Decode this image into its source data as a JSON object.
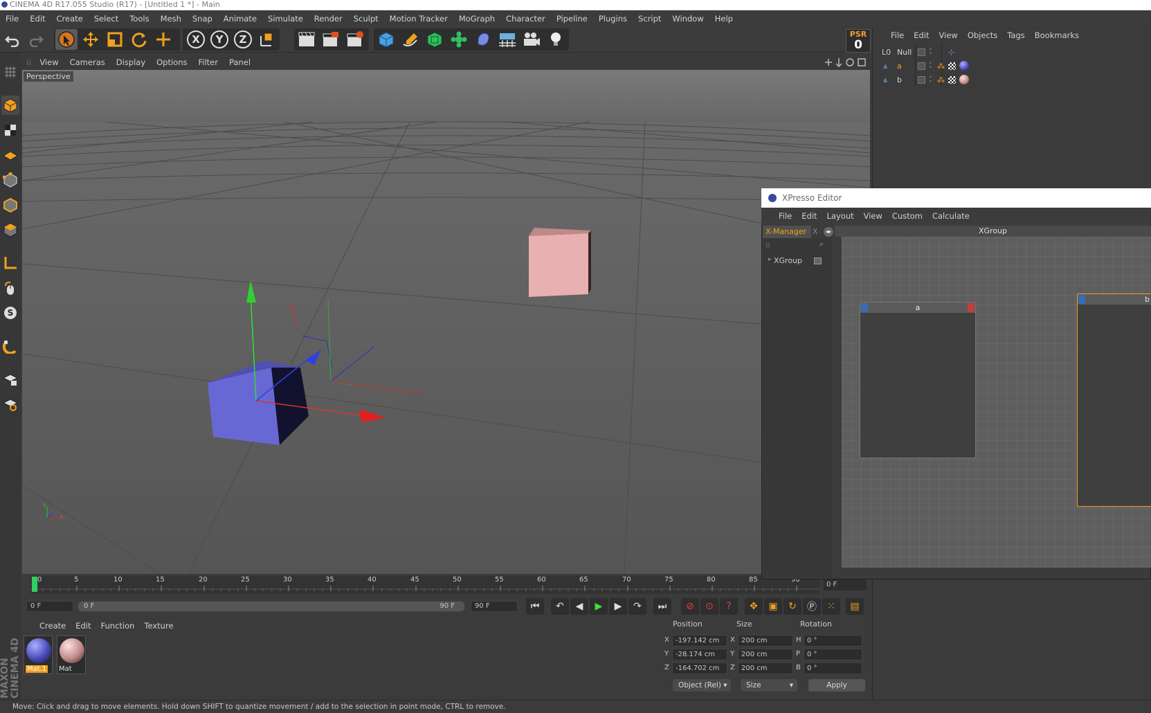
{
  "window": {
    "title": "CINEMA 4D R17.055 Studio (R17) - [Untitled 1 *] - Main"
  },
  "menubar": [
    "File",
    "Edit",
    "Create",
    "Select",
    "Tools",
    "Mesh",
    "Snap",
    "Animate",
    "Simulate",
    "Render",
    "Sculpt",
    "Motion Tracker",
    "MoGraph",
    "Character",
    "Pipeline",
    "Plugins",
    "Script",
    "Window",
    "Help"
  ],
  "toolbar": {
    "axis_x": "X",
    "axis_y": "Y",
    "axis_z": "Z",
    "psr_label": "PSR",
    "psr_value": "0",
    "icons": [
      "undo-icon",
      "redo-icon",
      "live-selection-icon",
      "move-icon",
      "scale-icon",
      "rotate-icon",
      "last-tool-icon",
      "x-axis-lock-icon",
      "y-axis-lock-icon",
      "z-axis-lock-icon",
      "coordinate-system-icon",
      "render-view-icon",
      "render-picture-viewer-icon",
      "render-settings-icon",
      "cube-icon",
      "pen-spline-icon",
      "subdivision-icon",
      "cloner-icon",
      "deformer-icon",
      "floor-icon",
      "camera-icon",
      "light-icon"
    ]
  },
  "viewport": {
    "menu": [
      "View",
      "Cameras",
      "Display",
      "Options",
      "Filter",
      "Panel"
    ],
    "label": "Perspective",
    "mini_axis": {
      "y": "Y",
      "z": "Z",
      "x": "X"
    },
    "colors": {
      "cube_a": "#6a6ad8",
      "cube_b": "#e8b0b0",
      "axis_x": "#e03030",
      "axis_y": "#30d030",
      "axis_z": "#3040e0"
    }
  },
  "timeline": {
    "ticks": [
      "0",
      "5",
      "10",
      "15",
      "20",
      "25",
      "30",
      "35",
      "40",
      "45",
      "50",
      "55",
      "60",
      "65",
      "70",
      "75",
      "80",
      "85",
      "90"
    ],
    "current_frame": "0 F",
    "start_field": "0 F",
    "range_start": "0 F",
    "range_end": "90 F",
    "end_field": "90 F",
    "progress": 0.0
  },
  "materials": {
    "menu": [
      "Create",
      "Edit",
      "Function",
      "Texture"
    ],
    "items": [
      {
        "name": "Mat.1",
        "color": "#4a4ab8",
        "selected": true
      },
      {
        "name": "Mat",
        "color": "#c08a8a",
        "selected": false
      }
    ]
  },
  "coordinates": {
    "headers": {
      "position": "Position",
      "size": "Size",
      "rotation": "Rotation"
    },
    "rows": [
      {
        "axis": "X",
        "pos": "-197.142 cm",
        "size_axis": "X",
        "size": "200 cm",
        "rot_axis": "H",
        "rot": "0 °"
      },
      {
        "axis": "Y",
        "pos": "-28.174 cm",
        "size_axis": "Y",
        "size": "200 cm",
        "rot_axis": "P",
        "rot": "0 °"
      },
      {
        "axis": "Z",
        "pos": "-164.702 cm",
        "size_axis": "Z",
        "size": "200 cm",
        "rot_axis": "B",
        "rot": "0 °"
      }
    ],
    "mode": "Object (Rel)",
    "size_mode": "Size",
    "apply": "Apply"
  },
  "status": "Move: Click and drag to move elements. Hold down SHIFT to quantize movement / add to the selection in point mode, CTRL to remove.",
  "brand": "MAXON CINEMA 4D",
  "objects": {
    "menu": [
      "File",
      "Edit",
      "View",
      "Objects",
      "Tags",
      "Bookmarks"
    ],
    "rows": [
      {
        "name": "Null",
        "type": "null"
      },
      {
        "name": "a",
        "type": "polygon"
      },
      {
        "name": "b",
        "type": "polygon"
      }
    ]
  },
  "xpresso": {
    "title": "XPresso Editor",
    "menu": [
      "File",
      "Edit",
      "Layout",
      "View",
      "Custom",
      "Calculate"
    ],
    "tab_active": "X-Manager",
    "tab_other": "X",
    "group_item": "XGroup",
    "group_header": "XGroup",
    "nodes": [
      {
        "name": "a"
      },
      {
        "name": "b"
      }
    ]
  }
}
